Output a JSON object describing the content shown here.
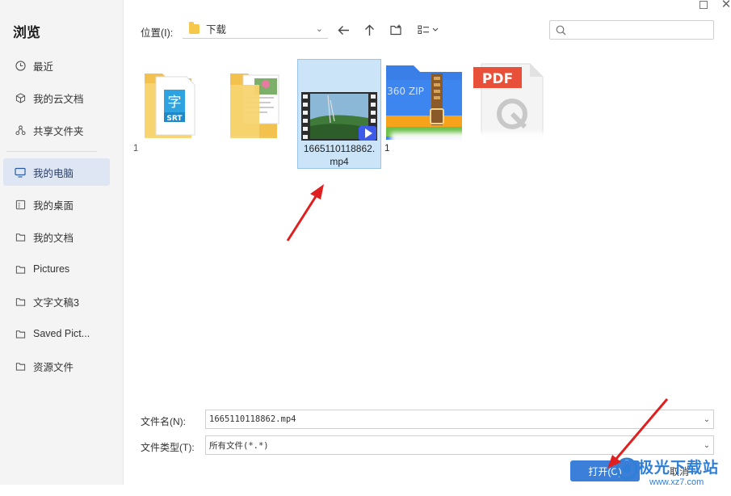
{
  "sidebar": {
    "title": "浏览",
    "items": [
      {
        "label": "最近",
        "icon": "clock-icon"
      },
      {
        "label": "我的云文档",
        "icon": "cube-icon"
      },
      {
        "label": "共享文件夹",
        "icon": "share-icon"
      },
      {
        "label": "我的电脑",
        "icon": "monitor-icon",
        "active": true
      },
      {
        "label": "我的桌面",
        "icon": "desktop-icon"
      },
      {
        "label": "我的文档",
        "icon": "folder-icon"
      },
      {
        "label": "Pictures",
        "icon": "folder-icon"
      },
      {
        "label": "文字文稿3",
        "icon": "folder-icon"
      },
      {
        "label": "Saved Pict...",
        "icon": "folder-icon"
      },
      {
        "label": "资源文件",
        "icon": "folder-icon"
      }
    ]
  },
  "toolbar": {
    "location_label": "位置(I):",
    "location_value": "下载",
    "back_icon": "arrow-left-icon",
    "up_icon": "arrow-up-icon",
    "new_folder_icon": "new-folder-icon",
    "view_icon": "view-mode-icon",
    "search_icon": "search-icon"
  },
  "files": [
    {
      "name": "1",
      "type": "srt-folder",
      "badge": "SRT",
      "glyph": "字"
    },
    {
      "name": "",
      "type": "image-folder"
    },
    {
      "name": "1665110118862.mp4",
      "type": "video",
      "selected": true
    },
    {
      "name": "1",
      "type": "zip",
      "badge": "360 ZIP"
    },
    {
      "name": "",
      "type": "pdf",
      "badge": "PDF"
    }
  ],
  "bottom": {
    "filename_label": "文件名(N):",
    "filename_value": "1665110118862.mp4",
    "filetype_label": "文件类型(T):",
    "filetype_value": "所有文件(*.*)",
    "open_label": "打开(O)",
    "cancel_label": "取消"
  },
  "watermark": {
    "text": "极光下载站",
    "url": "www.xz7.com"
  },
  "colors": {
    "accent": "#3b7fd9",
    "selection": "#cce4f7",
    "arrow": "#e02020"
  }
}
